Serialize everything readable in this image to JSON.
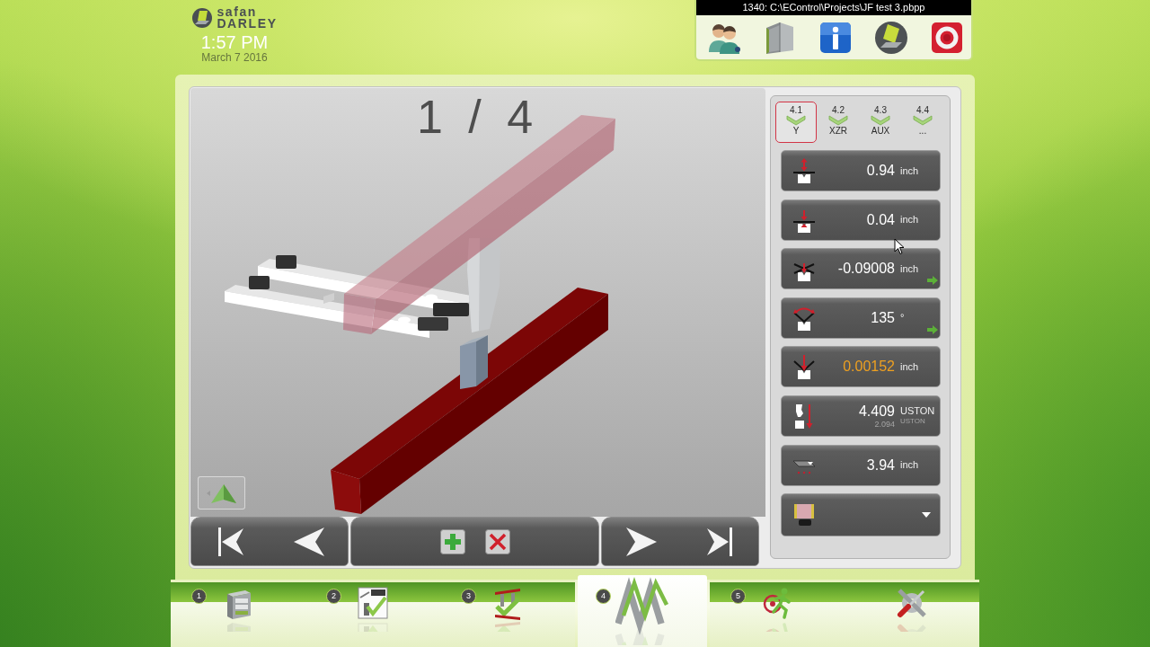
{
  "logo": {
    "line_1": "safan",
    "line_2": "DARLEY"
  },
  "clock": {
    "time": "1:57 PM",
    "date": "March 7 2016"
  },
  "file_bar": {
    "path": "1340: C:\\EControl\\Projects\\JF test 3.pbpp"
  },
  "viewport": {
    "step_counter": "1 / 4"
  },
  "axis_tabs": [
    {
      "number": "4.1",
      "label": "Y",
      "selected": true
    },
    {
      "number": "4.2",
      "label": "XZR",
      "selected": false
    },
    {
      "number": "4.3",
      "label": "AUX",
      "selected": false
    },
    {
      "number": "4.4",
      "label": "...",
      "selected": false
    }
  ],
  "readings": [
    {
      "kind": "reading",
      "value": "0.94",
      "unit": "inch",
      "highlighted": false,
      "indicator": false
    },
    {
      "kind": "reading",
      "value": "0.04",
      "unit": "inch",
      "highlighted": false,
      "indicator": false
    },
    {
      "kind": "reading",
      "value": "-0.09008",
      "unit": "inch",
      "highlighted": false,
      "indicator": true
    },
    {
      "kind": "reading",
      "value": "135",
      "unit": "°",
      "highlighted": false,
      "indicator": true
    },
    {
      "kind": "reading",
      "value": "0.00152",
      "unit": "inch",
      "highlighted": true,
      "indicator": false
    },
    {
      "kind": "reading",
      "value": "4.409",
      "unit": "USTON",
      "sub_value": "2.094",
      "sub_unit": "USTON",
      "highlighted": false,
      "indicator": false
    },
    {
      "kind": "reading",
      "value": "3.94",
      "unit": "inch",
      "highlighted": false,
      "indicator": false
    },
    {
      "kind": "select"
    }
  ],
  "nav_tabs": [
    {
      "number": "1",
      "selected": false
    },
    {
      "number": "2",
      "selected": false
    },
    {
      "number": "3",
      "selected": false
    },
    {
      "number": "4",
      "selected": true
    },
    {
      "number": "5",
      "selected": false
    },
    {
      "selected": false
    }
  ]
}
